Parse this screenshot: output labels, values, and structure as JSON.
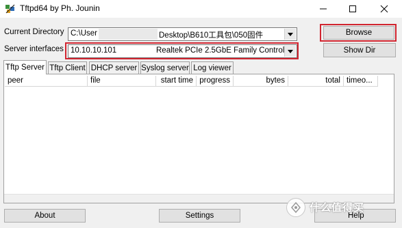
{
  "window": {
    "title": "Tftpd64 by Ph. Jounin",
    "minimize_icon": "minimize-icon",
    "maximize_icon": "maximize-icon",
    "close_icon": "close-icon"
  },
  "current_directory": {
    "label": "Current Directory",
    "value_prefix": "C:\\User",
    "value_suffix": "Desktop\\B610工具包\\050固件"
  },
  "server_interfaces": {
    "label": "Server interfaces",
    "ip": "10.10.10.101",
    "adapter": "Realtek PCIe 2.5GbE Family Controller"
  },
  "buttons": {
    "browse": "Browse",
    "show_dir": "Show Dir",
    "about": "About",
    "settings": "Settings",
    "help": "Help"
  },
  "tabs": [
    "Tftp Server",
    "Tftp Client",
    "DHCP server",
    "Syslog server",
    "Log viewer"
  ],
  "table": {
    "columns": [
      "peer",
      "file",
      "start time",
      "progress",
      "bytes",
      "total",
      "timeo..."
    ]
  },
  "watermark": {
    "text": "什么值得买"
  },
  "colors": {
    "highlight": "#d1242f",
    "window_bg": "#f0f0f0"
  }
}
